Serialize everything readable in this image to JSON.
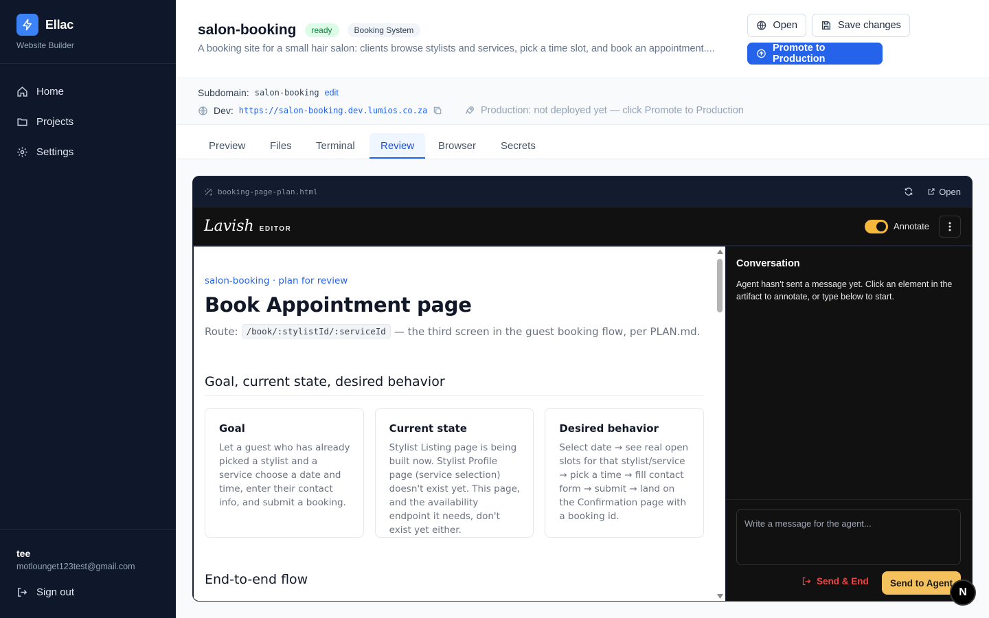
{
  "brand": {
    "name": "Ellac",
    "subtitle": "Website Builder"
  },
  "nav": [
    {
      "label": "Home",
      "icon": "home-icon"
    },
    {
      "label": "Projects",
      "icon": "folder-icon"
    },
    {
      "label": "Settings",
      "icon": "gear-icon"
    }
  ],
  "user": {
    "name": "tee",
    "email": "motlounget123test@gmail.com",
    "signout": "Sign out"
  },
  "project": {
    "title": "salon-booking",
    "status": "ready",
    "type": "Booking System",
    "description": "A booking site for a small hair salon: clients browse stylists and services, pick a time slot, and book an appointment...."
  },
  "actions": {
    "open": "Open",
    "save": "Save changes",
    "promote": "Promote to Production"
  },
  "meta": {
    "subdomain_label": "Subdomain:",
    "subdomain": "salon-booking",
    "edit": "edit",
    "dev_label": "Dev:",
    "dev_url": "https://salon-booking.dev.lumios.co.za",
    "production": "Production: not deployed yet — click Promote to Production"
  },
  "tabs": [
    "Preview",
    "Files",
    "Terminal",
    "Review",
    "Browser",
    "Secrets"
  ],
  "active_tab": "Review",
  "panel": {
    "file": "booking-page-plan.html",
    "open": "Open"
  },
  "editor": {
    "logo": "Lavish",
    "label": "EDITOR",
    "annotate": "Annotate",
    "annotate_on": true
  },
  "doc": {
    "crumb": "salon-booking · plan for review",
    "title": "Book Appointment page",
    "route_label": "Route:",
    "route_code": "/book/:stylistId/:serviceId",
    "route_note": "— the third screen in the guest booking flow, per PLAN.md.",
    "section1": "Goal, current state, desired behavior",
    "cards": [
      {
        "title": "Goal",
        "body": "Let a guest who has already picked a stylist and a service choose a date and time, enter their contact info, and submit a booking."
      },
      {
        "title": "Current state",
        "body": "Stylist Listing page is being built now. Stylist Profile page (service selection) doesn't exist yet. This page, and the availability endpoint it needs, don't exist yet either."
      },
      {
        "title": "Desired behavior",
        "body": "Select date → see real open slots for that stylist/service → pick a time → fill contact form → submit → land on the Confirmation page with a booking id."
      }
    ],
    "section2": "End-to-end flow"
  },
  "conversation": {
    "title": "Conversation",
    "empty": "Agent hasn't sent a message yet. Click an element in the artifact to annotate, or type below to start.",
    "placeholder": "Write a message for the agent...",
    "send_end": "Send & End",
    "send_agent": "Send to Agent"
  },
  "floating_badge": "N",
  "colors": {
    "accent": "#2563eb",
    "sidebar": "#0f172a",
    "toggle": "#f5b83a",
    "danger": "#ef4444"
  }
}
